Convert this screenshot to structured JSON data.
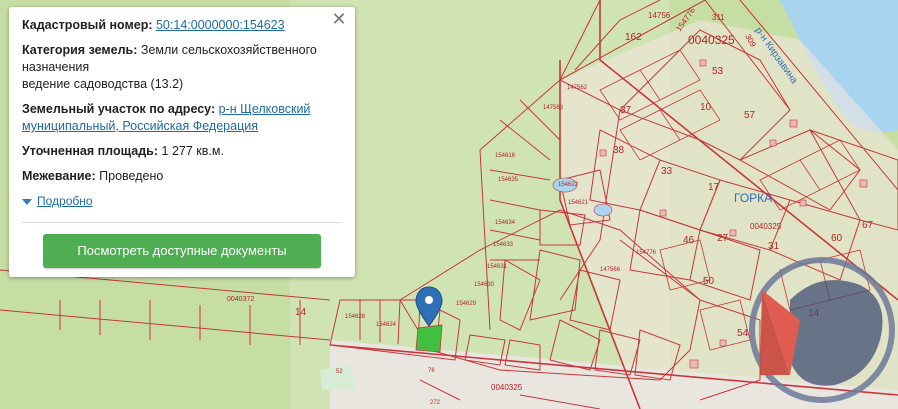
{
  "popup": {
    "cadastral_label": "Кадастровый номер:",
    "cadastral_value": "50:14:0000000:154623",
    "category_label": "Категория земель:",
    "category_value_1": "Земли сельскохозяйственного",
    "category_value_2": "назначения",
    "category_value_3": "ведение садоводства (13.2)",
    "address_label": "Земельный участок по адресу:",
    "address_value_1": "р-н Щелковский",
    "address_value_2": "муниципальный, Российская Федерация",
    "area_label": "Уточненная площадь:",
    "area_value": "1 277 кв.м.",
    "survey_label": "Межевание:",
    "survey_value": "Проведено",
    "more_label": "Подробно",
    "docs_button": "Посмотреть доступные документы"
  },
  "map": {
    "labels": {
      "l162": "162",
      "l14756": "14756",
      "l154776": "154776",
      "l311": "311",
      "l309": "309",
      "l40325_top": "0040325",
      "street": "р-н Кирзавина",
      "l53": "53",
      "l57": "57",
      "l10": "10",
      "l33": "33",
      "l38": "38",
      "l27": "27",
      "l50": "50",
      "l46": "46",
      "l17": "17",
      "l31": "31",
      "l60": "60",
      "l67": "67",
      "l37": "37",
      "gorka": "ГОРКА",
      "l40325_mid": "0040325",
      "l40372": "0040372",
      "l14_left": "14",
      "l14_right": "14",
      "l54": "54",
      "l40325_bot": "0040325",
      "l154616": "154616",
      "l154635": "154635",
      "l154634": "154634",
      "l154633": "154633",
      "l154631": "154631",
      "l154630": "154630",
      "l154629": "154629",
      "l154622": "154622",
      "l154621": "154621",
      "l147566": "147566",
      "l147563": "147563",
      "l147562": "147562",
      "l154628": "154628",
      "l154624": "154624",
      "l154776b": "154776",
      "l52": "52",
      "l76": "76",
      "l272": "272"
    }
  },
  "colors": {
    "parcel_line": "#c8373b",
    "water": "#a8d4ef",
    "selected": "#3fc13f",
    "marker": "#2f6fb5",
    "button": "#4fae51"
  },
  "icons": {
    "marker": "map-pin-icon",
    "close": "close-icon",
    "more": "triangle-down-icon",
    "watermark": "compass-logo"
  }
}
